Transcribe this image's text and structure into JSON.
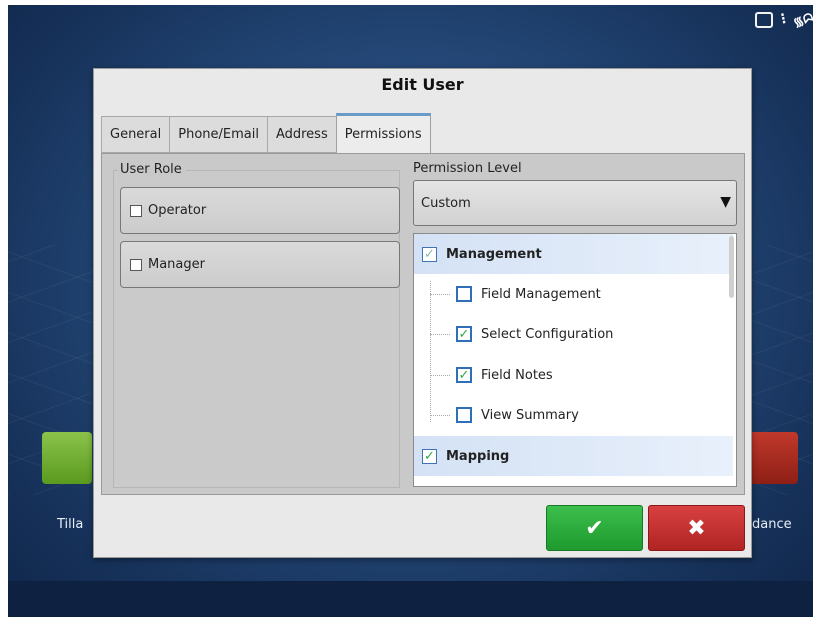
{
  "dialog": {
    "title": "Edit User"
  },
  "tabs": [
    {
      "label": "General"
    },
    {
      "label": "Phone/Email"
    },
    {
      "label": "Address"
    },
    {
      "label": "Permissions",
      "active": true
    }
  ],
  "user_role": {
    "title": "User Role",
    "options": [
      {
        "label": "Operator",
        "checked": false
      },
      {
        "label": "Manager",
        "checked": false
      }
    ]
  },
  "permission_level": {
    "label": "Permission Level",
    "selected": "Custom",
    "dropdown_icon": "triangle-down-icon"
  },
  "permissions": {
    "groups": [
      {
        "label": "Management",
        "state": "partial",
        "children": [
          {
            "label": "Field Management",
            "checked": false
          },
          {
            "label": "Select Configuration",
            "checked": true
          },
          {
            "label": "Field Notes",
            "checked": true
          },
          {
            "label": "View Summary",
            "checked": false
          }
        ]
      },
      {
        "label": "Mapping",
        "state": "checked",
        "children": []
      }
    ]
  },
  "actions": {
    "ok_icon": "check-icon",
    "ok_glyph": "✔",
    "cancel_icon": "close-icon",
    "cancel_glyph": "✖"
  },
  "background_apps": {
    "left_label": "Tilla",
    "right_label": "dance"
  },
  "colors": {
    "ok": "#2db13d",
    "cancel": "#c83232",
    "accent": "#2f6fb8",
    "background": "#244878"
  }
}
